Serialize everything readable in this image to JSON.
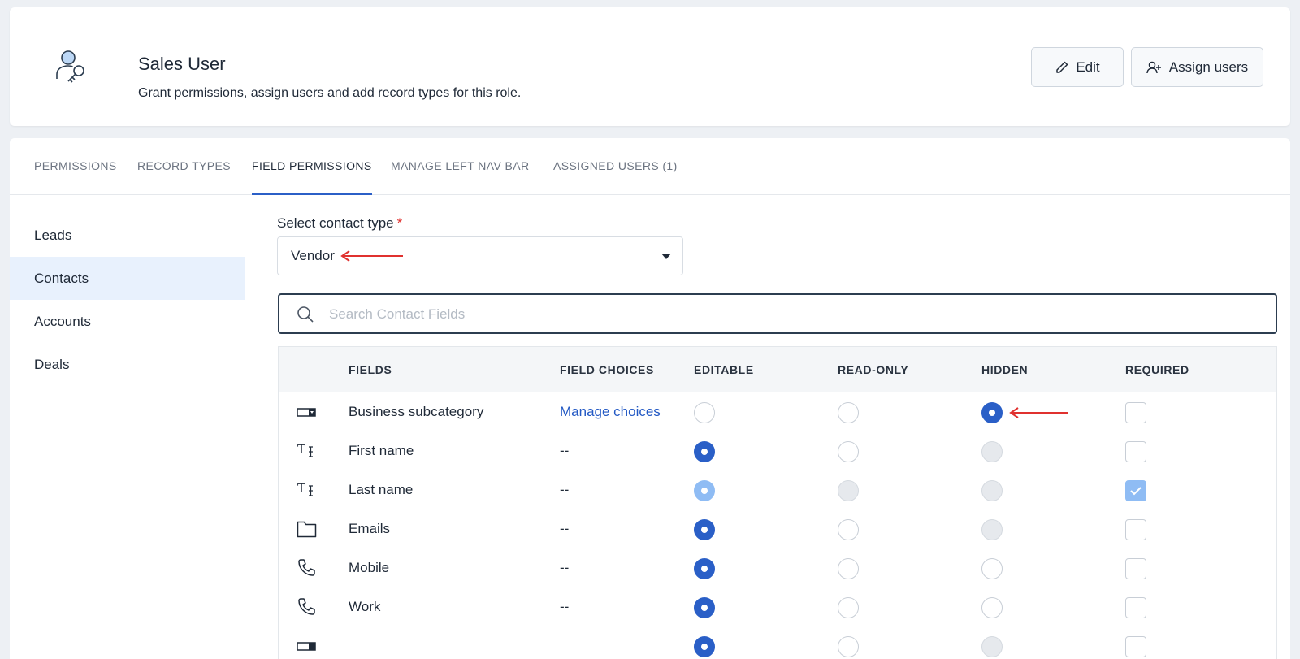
{
  "header": {
    "title": "Sales User",
    "subtitle": "Grant permissions, assign users and add record types for this role.",
    "icon": "user-key-icon",
    "edit_label": "Edit",
    "assign_label": "Assign users"
  },
  "tabs": [
    {
      "label": "PERMISSIONS",
      "active": false
    },
    {
      "label": "RECORD TYPES",
      "active": false
    },
    {
      "label": "FIELD PERMISSIONS",
      "active": true
    },
    {
      "label": "MANAGE LEFT NAV BAR",
      "active": false
    },
    {
      "label": "ASSIGNED USERS (1)",
      "active": false
    }
  ],
  "sidenav": [
    {
      "label": "Leads",
      "active": false
    },
    {
      "label": "Contacts",
      "active": true
    },
    {
      "label": "Accounts",
      "active": false
    },
    {
      "label": "Deals",
      "active": false
    }
  ],
  "contact_type": {
    "label": "Select contact type",
    "required_mark": "*",
    "value": "Vendor"
  },
  "search": {
    "placeholder": "Search Contact Fields",
    "value": ""
  },
  "table": {
    "headers": [
      "FIELDS",
      "FIELD CHOICES",
      "EDITABLE",
      "READ-ONLY",
      "HIDDEN",
      "REQUIRED"
    ],
    "rows": [
      {
        "icon": "dropdown-field-icon",
        "field": "Business subcategory",
        "choices": "Manage choices",
        "choices_link": true,
        "editable": "off",
        "readonly": "off",
        "hidden": "on",
        "required": "off"
      },
      {
        "icon": "text-field-icon",
        "field": "First name",
        "choices": "--",
        "choices_link": false,
        "editable": "on",
        "readonly": "off",
        "hidden": "disabled",
        "required": "off"
      },
      {
        "icon": "text-field-icon",
        "field": "Last name",
        "choices": "--",
        "choices_link": false,
        "editable": "on-disabled",
        "readonly": "disabled",
        "hidden": "disabled",
        "required": "checked-disabled"
      },
      {
        "icon": "folder-icon",
        "field": "Emails",
        "choices": "--",
        "choices_link": false,
        "editable": "on",
        "readonly": "off",
        "hidden": "disabled",
        "required": "off"
      },
      {
        "icon": "phone-icon",
        "field": "Mobile",
        "choices": "--",
        "choices_link": false,
        "editable": "on",
        "readonly": "off",
        "hidden": "off",
        "required": "off"
      },
      {
        "icon": "phone-icon",
        "field": "Work",
        "choices": "--",
        "choices_link": false,
        "editable": "on",
        "readonly": "off",
        "hidden": "off",
        "required": "off"
      }
    ]
  },
  "colors": {
    "accent": "#2a5fc7",
    "link": "#2359c4",
    "annotation_arrow": "#e0312f",
    "active_nav_bg": "#e8f1fd"
  }
}
